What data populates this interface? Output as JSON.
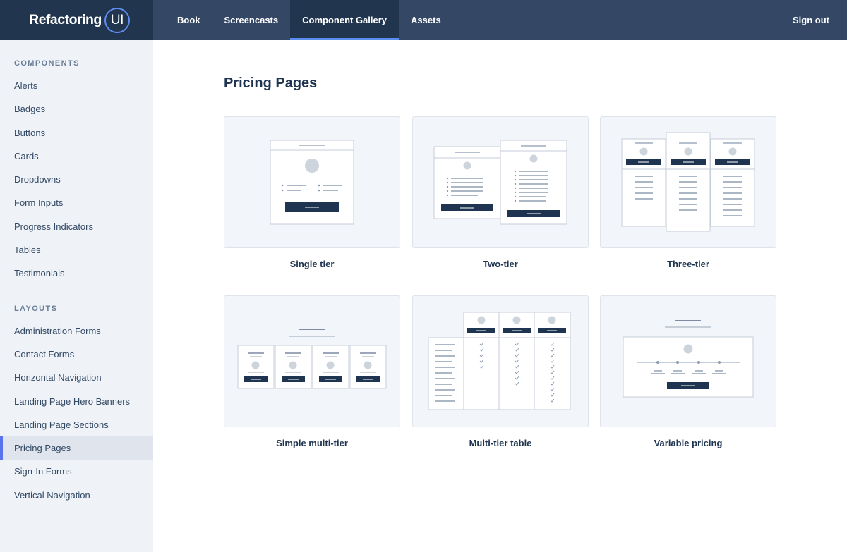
{
  "brand": {
    "name": "Refactoring",
    "badge": "UI"
  },
  "nav": {
    "items": [
      {
        "label": "Book"
      },
      {
        "label": "Screencasts"
      },
      {
        "label": "Component Gallery"
      },
      {
        "label": "Assets"
      }
    ],
    "active": "Component Gallery",
    "signout": "Sign out"
  },
  "sidebar": {
    "components_title": "COMPONENTS",
    "components": [
      {
        "label": "Alerts"
      },
      {
        "label": "Badges"
      },
      {
        "label": "Buttons"
      },
      {
        "label": "Cards"
      },
      {
        "label": "Dropdowns"
      },
      {
        "label": "Form Inputs"
      },
      {
        "label": "Progress Indicators"
      },
      {
        "label": "Tables"
      },
      {
        "label": "Testimonials"
      }
    ],
    "layouts_title": "LAYOUTS",
    "layouts": [
      {
        "label": "Administration Forms"
      },
      {
        "label": "Contact Forms"
      },
      {
        "label": "Horizontal Navigation"
      },
      {
        "label": "Landing Page Hero Banners"
      },
      {
        "label": "Landing Page Sections"
      },
      {
        "label": "Pricing Pages"
      },
      {
        "label": "Sign-In Forms"
      },
      {
        "label": "Vertical Navigation"
      }
    ],
    "active": "Pricing Pages"
  },
  "main": {
    "title": "Pricing Pages",
    "cards": [
      {
        "label": "Single tier"
      },
      {
        "label": "Two-tier"
      },
      {
        "label": "Three-tier"
      },
      {
        "label": "Simple multi-tier"
      },
      {
        "label": "Multi-tier table"
      },
      {
        "label": "Variable pricing"
      }
    ]
  },
  "colors": {
    "nav_bg": "#344866",
    "brand_bg": "#22354f",
    "accent": "#5b8def",
    "sidebar_bg": "#eff2f7",
    "card_bg": "#f2f5f9",
    "dark_button": "#1f3450"
  }
}
